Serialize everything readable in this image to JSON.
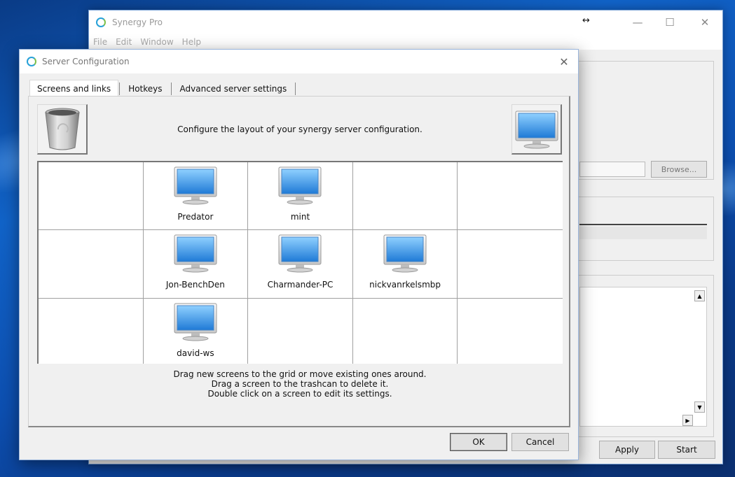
{
  "main_window": {
    "title": "Synergy Pro",
    "resize_glyph": "↔",
    "menu": [
      "File",
      "Edit",
      "Window",
      "Help"
    ],
    "browse_label": "Browse...",
    "apply_label": "Apply",
    "start_label": "Start"
  },
  "dialog": {
    "title": "Server Configuration",
    "close_glyph": "✕",
    "tabs": [
      "Screens and links",
      "Hotkeys",
      "Advanced server settings"
    ],
    "layout_description": "Configure the layout of your synergy server configuration.",
    "grid": [
      [
        "",
        "Predator",
        "mint",
        "",
        ""
      ],
      [
        "",
        "Jon-BenchDen",
        "Charmander-PC",
        "nickvanrkelsmbp",
        ""
      ],
      [
        "",
        "david-ws",
        "",
        "",
        ""
      ]
    ],
    "instructions": [
      "Drag new screens to the grid or move existing ones around.",
      "Drag a screen to the trashcan to delete it.",
      "Double click on a screen to edit its settings."
    ],
    "ok_label": "OK",
    "cancel_label": "Cancel"
  },
  "icons": {
    "app": "synergy-logo-icon",
    "trash": "trash-can-icon",
    "screen": "monitor-icon"
  },
  "colors": {
    "desktop": "#0d4fb0",
    "window_bg": "#f0f0f0",
    "monitor_screen": "#3a9be8"
  }
}
